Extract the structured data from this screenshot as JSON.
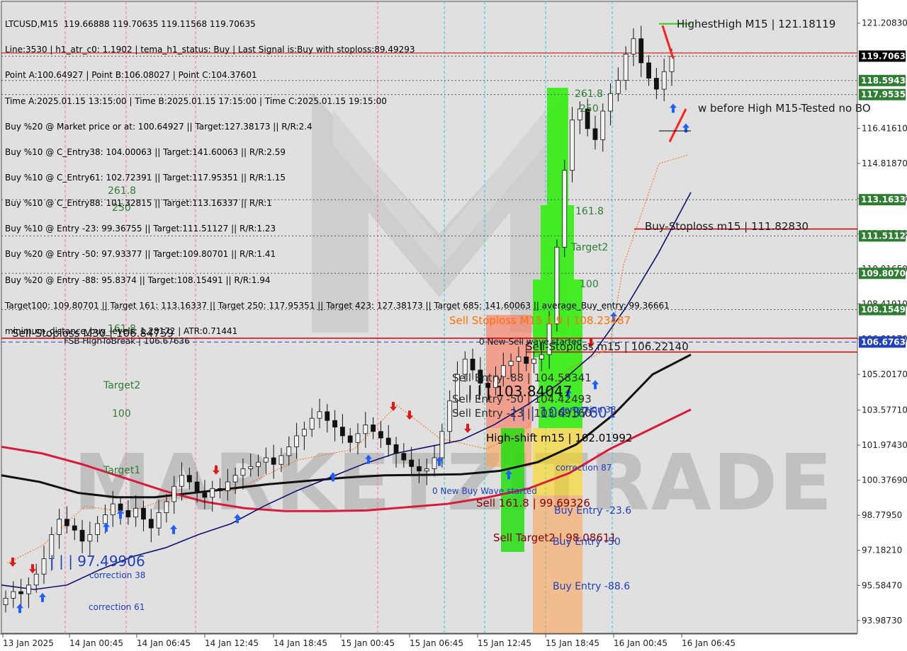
{
  "symbol_header": {
    "symbol": "LTCUSD,M15",
    "ohlc": "119.66888 119.70635 119.11568 119.70635"
  },
  "info_lines": [
    "Line:3530 | h1_atr_c0: 1.1902 | tema_h1_status: Buy | Last Signal is:Buy with stoploss:89.49293",
    "Point A:100.64927 | Point B:106.08027 | Point C:104.37601",
    "Time A:2025.01.15 13:15:00 | Time B:2025.01.15 17:15:00 | Time C:2025.01.15 19:15:00",
    "Buy %20 @ Market price or at: 100.64927 || Target:127.38173 || R/R:2.4",
    "Buy %10 @ C_Entry38: 104.00063 || Target:141.60063 || R/R:2.59",
    "Buy %10 @ C_Entry61: 102.72391 || Target:117.95351 || R/R:1.15",
    "Buy %10 @ C_Entry88: 101.32815 || Target:113.16337 || R/R:1",
    "Buy %10 @ Entry -23: 99.36755 || Target:111.51127 || R/R:1.23",
    "Buy %20 @ Entry -50: 97.93377 || Target:109.80701 || R/R:1.41",
    "Buy %20 @ Entry -88: 95.8374 || Target:108.15491 || R/R:1.94",
    "Target100: 109.80701 || Target 161: 113.16337 || Target 250: 117.95351 || Target 423: 127.38173 || Target 685: 141.60063 || average_Buy_entry: 99.36661",
    "minimum_distance_buy_levels: 1.28172 | ATR:0.71441"
  ],
  "price_axis": {
    "ticks": [
      "121.20830",
      "116.41610",
      "114.81870",
      "113.21130",
      "111.61390",
      "110.01650",
      "108.41910",
      "106.81170",
      "105.20170",
      "103.57710",
      "101.97430",
      "100.37690",
      "98.77950",
      "97.18210",
      "95.58470",
      "93.98730"
    ],
    "tick_values": [
      121.2083,
      116.4161,
      114.8187,
      113.2113,
      111.6139,
      110.0165,
      108.4191,
      106.8117,
      105.2017,
      103.5771,
      101.9743,
      100.3769,
      98.7795,
      97.1821,
      95.5847,
      93.9873
    ],
    "tags": [
      {
        "label": "119.70635",
        "value": 119.70635,
        "bg": "#000000",
        "fg": "#ffffff"
      },
      {
        "label": "118.59437",
        "value": 118.59437,
        "bg": "#2e7d32",
        "fg": "#ffffff"
      },
      {
        "label": "117.95351",
        "value": 117.95351,
        "bg": "#2e7d32",
        "fg": "#ffffff"
      },
      {
        "label": "113.16337",
        "value": 113.16337,
        "bg": "#2e7d32",
        "fg": "#ffffff"
      },
      {
        "label": "111.51127",
        "value": 111.51127,
        "bg": "#2e7d32",
        "fg": "#ffffff"
      },
      {
        "label": "109.80701",
        "value": 109.80701,
        "bg": "#2e7d32",
        "fg": "#ffffff"
      },
      {
        "label": "108.15491",
        "value": 108.15491,
        "bg": "#2e7d32",
        "fg": "#ffffff"
      },
      {
        "label": "106.67636",
        "value": 106.67636,
        "bg": "#1f3fbf",
        "fg": "#ffffff"
      }
    ]
  },
  "time_axis": [
    "13 Jan 2025",
    "14 Jan 00:45",
    "14 Jan 06:45",
    "14 Jan 12:45",
    "14 Jan 18:45",
    "15 Jan 00:45",
    "15 Jan 06:45",
    "15 Jan 12:45",
    "15 Jan 18:45",
    "16 Jan 00:45",
    "16 Jan 06:45"
  ],
  "watermark": "MARKETZITRADE",
  "chart_data": {
    "type": "candlestick",
    "symbol": "LTCUSD",
    "timeframe": "M15",
    "y_range": [
      93.4,
      122.2
    ],
    "candles_close": [
      95.0,
      95.3,
      95.2,
      95.6,
      96.1,
      96.8,
      97.9,
      98.6,
      98.3,
      98.1,
      97.6,
      97.9,
      98.4,
      98.8,
      99.3,
      99.0,
      98.7,
      99.1,
      98.6,
      98.2,
      98.9,
      99.4,
      100.1,
      100.6,
      100.3,
      99.8,
      99.6,
      100.0,
      99.9,
      100.3,
      100.6,
      100.9,
      101.0,
      101.2,
      101.4,
      101.1,
      101.5,
      101.9,
      102.4,
      102.7,
      103.2,
      103.5,
      103.1,
      102.8,
      102.4,
      102.1,
      102.5,
      102.9,
      102.6,
      102.3,
      102.0,
      101.6,
      101.3,
      101.0,
      100.8,
      100.9,
      101.4,
      102.6,
      104.0,
      105.2,
      105.9,
      105.4,
      104.8,
      104.6,
      105.1,
      105.6,
      105.8,
      106.0,
      105.7,
      105.9,
      106.1,
      107.5,
      111.0,
      114.5,
      116.8,
      117.3,
      116.4,
      115.9,
      117.2,
      118.0,
      118.6,
      119.8,
      120.5,
      119.4,
      118.7,
      118.2,
      119.0,
      119.7
    ],
    "series": [
      {
        "name": "MA black",
        "values": [
          100.6,
          100.3,
          99.8,
          99.6,
          99.6,
          99.8,
          100.0,
          100.2,
          100.35,
          100.5,
          100.6,
          100.62,
          100.65,
          100.8,
          101.2,
          102.0,
          103.4,
          105.2,
          106.1
        ]
      },
      {
        "name": "MA red",
        "values": [
          101.9,
          101.6,
          101.1,
          100.5,
          99.9,
          99.4,
          99.1,
          98.97,
          98.97,
          99.0,
          99.15,
          99.3,
          99.6,
          100.0,
          100.7,
          101.8,
          102.7,
          103.6
        ]
      },
      {
        "name": "MA blue",
        "values": [
          95.6,
          95.4,
          95.6,
          96.3,
          96.9,
          97.3,
          97.9,
          98.4,
          99.2,
          99.9,
          100.5,
          101.1,
          101.6,
          101.9,
          102.2,
          102.9,
          103.8,
          104.8,
          106.1,
          108.2,
          110.7,
          113.5
        ]
      }
    ],
    "levels": [
      {
        "label": "HighestHigh   M15 | 121.18119",
        "value": 121.18119,
        "color": "#1a1a1a"
      },
      {
        "label": "Buy-Stoploss m15 | 111.82830",
        "value": 111.8283,
        "color": "#1a1a1a"
      },
      {
        "label": "Sell-Stoploss M30 | 106.84759",
        "value": 106.84759,
        "color": "#1a1a1a"
      },
      {
        "label": "FSB HighToBreak | 106.67636",
        "value": 106.67636,
        "color": "#1a1a1a"
      },
      {
        "label": "Sell-Stoploss m15 | 106.22140",
        "value": 106.2214,
        "color": "#1a1a1a"
      },
      {
        "label": "0 New Sell wave started",
        "value": 106.85,
        "color": "#1a1a1a"
      },
      {
        "label": "0 New Buy Wave started",
        "value": 100.15,
        "color": "#1f3fbf"
      },
      {
        "label": "| | | 103.84047",
        "value": 103.84047,
        "color": "#000000"
      },
      {
        "label": "| | | 104.37601",
        "value": 104.37601,
        "color": "#1f3fbf"
      },
      {
        "label": "| | | 97.49906",
        "value": 97.49906,
        "color": "#1f3fbf"
      },
      {
        "label": "High-shift m15 | 102.01992",
        "value": 102.01992,
        "color": "#000000"
      },
      {
        "label": "Sell Stoploss M15 1.9 | 108.23487",
        "value": 108.23487,
        "color": "#ff6f00"
      },
      {
        "label": "Sell 161.8 | 99.69326",
        "value": 99.69326,
        "color": "#8b0000"
      },
      {
        "label": "Sell Target2 | 98.08611",
        "value": 98.08611,
        "color": "#8b0000"
      },
      {
        "label": "Sell Entry -88 | 104.58341",
        "value": 104.58341,
        "color": "#2e2e2e"
      },
      {
        "label": "Sell Entry -50 | 104.42493",
        "value": 104.42493,
        "color": "#2e2e2e"
      },
      {
        "label": "Sell Entry -23 | 103.69160",
        "value": 103.6916,
        "color": "#2e2e2e"
      }
    ],
    "annotations": [
      "Buy Entry -23.6",
      "Buy Entry -50",
      "Buy Entry -88.6",
      "correction 38",
      "correction 61",
      "correction 87",
      "correction 38",
      "Target1",
      "Target2",
      "100",
      "161.8",
      "250",
      "261.8",
      "Target2",
      "100",
      "161.8",
      "261.8",
      "250",
      "w before High   M15-Tested no BO"
    ]
  }
}
